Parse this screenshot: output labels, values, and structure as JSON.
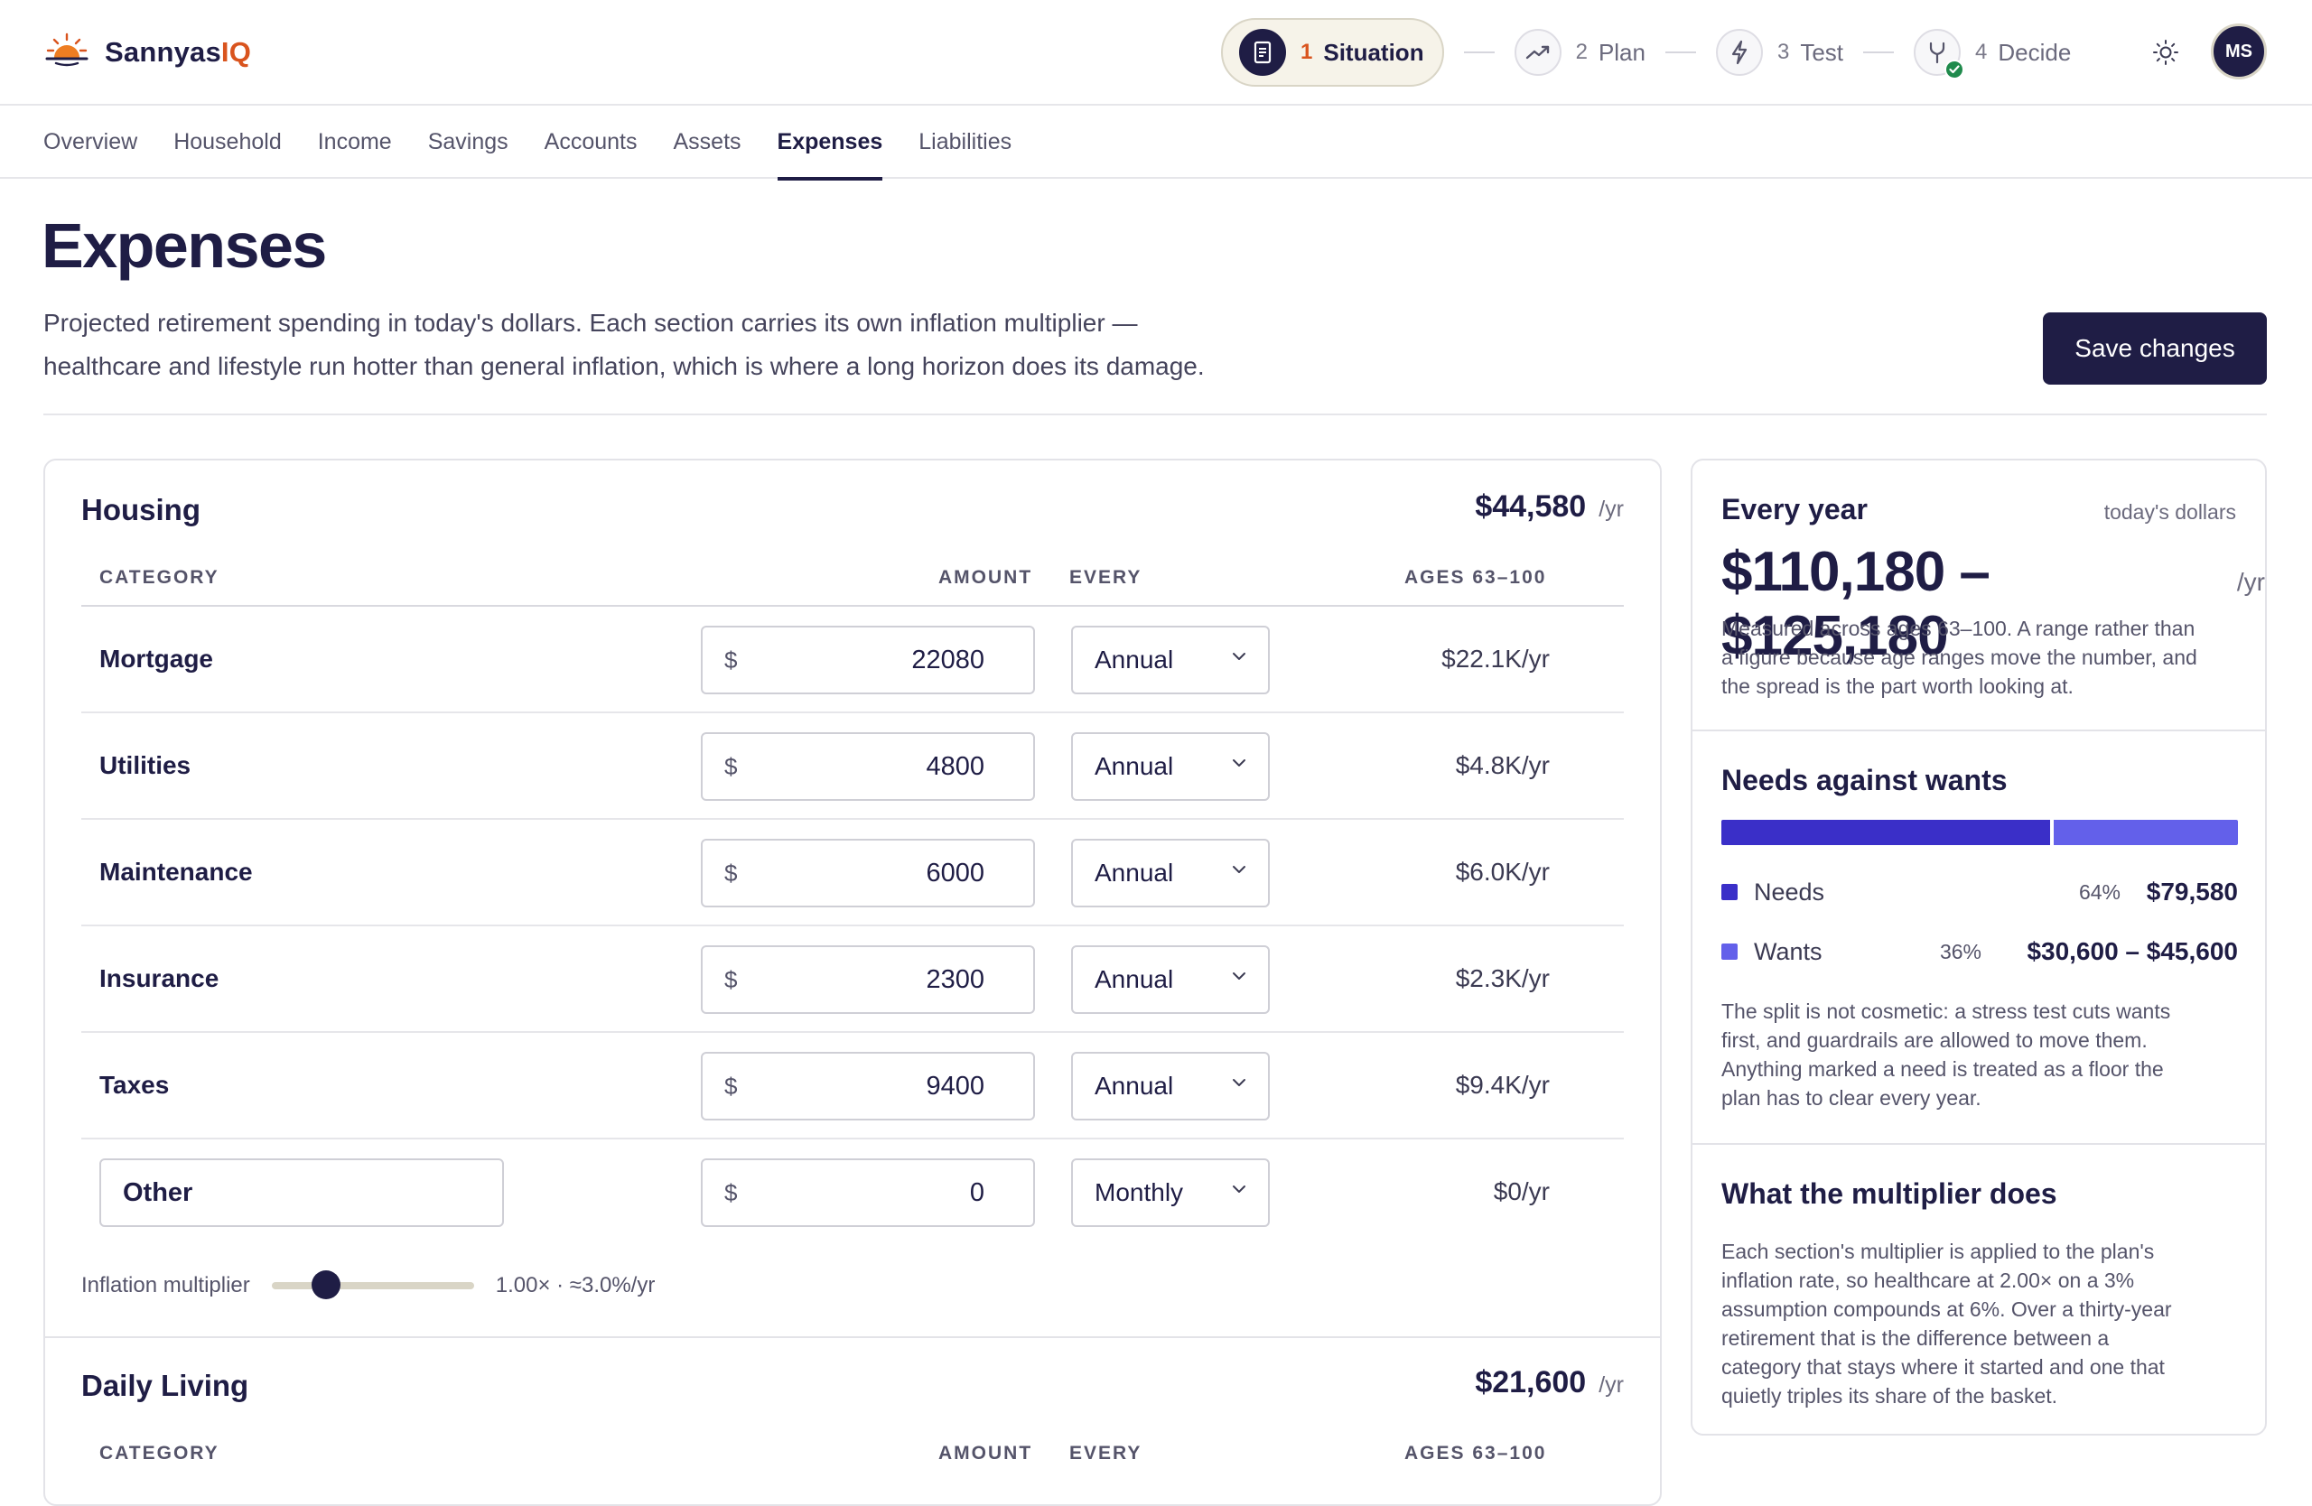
{
  "app": {
    "brand_prefix": "Sannyas",
    "brand_suffix": "IQ"
  },
  "steps": [
    {
      "num": "1",
      "label": "Situation",
      "icon": "document-icon",
      "active": true
    },
    {
      "num": "2",
      "label": "Plan",
      "icon": "trend-up-icon"
    },
    {
      "num": "3",
      "label": "Test",
      "icon": "lightning-icon"
    },
    {
      "num": "4",
      "label": "Decide",
      "icon": "fork-icon",
      "completed_badge": "check-icon"
    }
  ],
  "user": {
    "initials": "MS"
  },
  "subnav": [
    "Overview",
    "Household",
    "Income",
    "Savings",
    "Accounts",
    "Assets",
    "Expenses",
    "Liabilities"
  ],
  "subnav_active": "Expenses",
  "page": {
    "title": "Expenses",
    "description_line1": "Projected retirement spending in today's dollars. Each section carries its own inflation multiplier —",
    "description_line2": "healthcare and lifestyle run hotter than general inflation, which is where a long horizon does its damage.",
    "save_label": "Save changes"
  },
  "table_headers": {
    "category": "CATEGORY",
    "amount": "AMOUNT",
    "every": "EVERY",
    "ages": "AGES 63–100"
  },
  "housing": {
    "title": "Housing",
    "total": "$44,580",
    "per": "/yr",
    "currency": "$",
    "rows": [
      {
        "label": "Mortgage",
        "amount": "22080",
        "frequency": "Annual",
        "projection": "$22.1K/yr"
      },
      {
        "label": "Utilities",
        "amount": "4800",
        "frequency": "Annual",
        "projection": "$4.8K/yr"
      },
      {
        "label": "Maintenance",
        "amount": "6000",
        "frequency": "Annual",
        "projection": "$6.0K/yr"
      },
      {
        "label": "Insurance",
        "amount": "2300",
        "frequency": "Annual",
        "projection": "$2.3K/yr"
      },
      {
        "label": "Taxes",
        "amount": "9400",
        "frequency": "Annual",
        "projection": "$9.4K/yr"
      },
      {
        "label": "Other",
        "amount": "0",
        "frequency": "Monthly",
        "projection": "$0/yr",
        "editable_label": true
      }
    ],
    "inflation_label": "Inflation multiplier",
    "inflation_value": "1.00× · ≈3.0%/yr",
    "inflation_slider_fraction": 0.25
  },
  "daily_living": {
    "title": "Daily Living",
    "total": "$21,600",
    "per": "/yr"
  },
  "summary": {
    "every_year": {
      "title": "Every year",
      "note": "today's dollars",
      "range": "$110,180 – $125,180",
      "per": "/yr",
      "desc_lines": [
        "Measured across ages 63–100. A range rather than",
        "a figure because age ranges move the number, and",
        "the spread is the part worth looking at."
      ]
    },
    "needs_wants": {
      "title": "Needs against wants",
      "needs_fraction": 0.64,
      "wants_fraction": 0.36,
      "needs_color": "#3a2fc8",
      "wants_color": "#6360ea",
      "needs": {
        "label": "Needs",
        "pct": "64%",
        "amount": "$79,580"
      },
      "wants": {
        "label": "Wants",
        "pct": "36%",
        "amount": "$30,600 – $45,600"
      },
      "desc_lines": [
        "The split is not cosmetic: a stress test cuts wants",
        "first, and guardrails are allowed to move them.",
        "Anything marked a need is treated as a floor the",
        "plan has to clear every year."
      ]
    },
    "multiplier": {
      "title": "What the multiplier does",
      "desc_lines": [
        "Each section's multiplier is applied to the plan's",
        "inflation rate, so healthcare at 2.00× on a 3%",
        "assumption compounds at 6%. Over a thirty-year",
        "retirement that is the difference between a",
        "category that stays where it started and one that",
        "quietly triples its share of the basket."
      ]
    }
  },
  "colors": {
    "navy": "#1f1d45",
    "accent_orange": "#d9541e",
    "success_green": "#1f8a4c"
  }
}
